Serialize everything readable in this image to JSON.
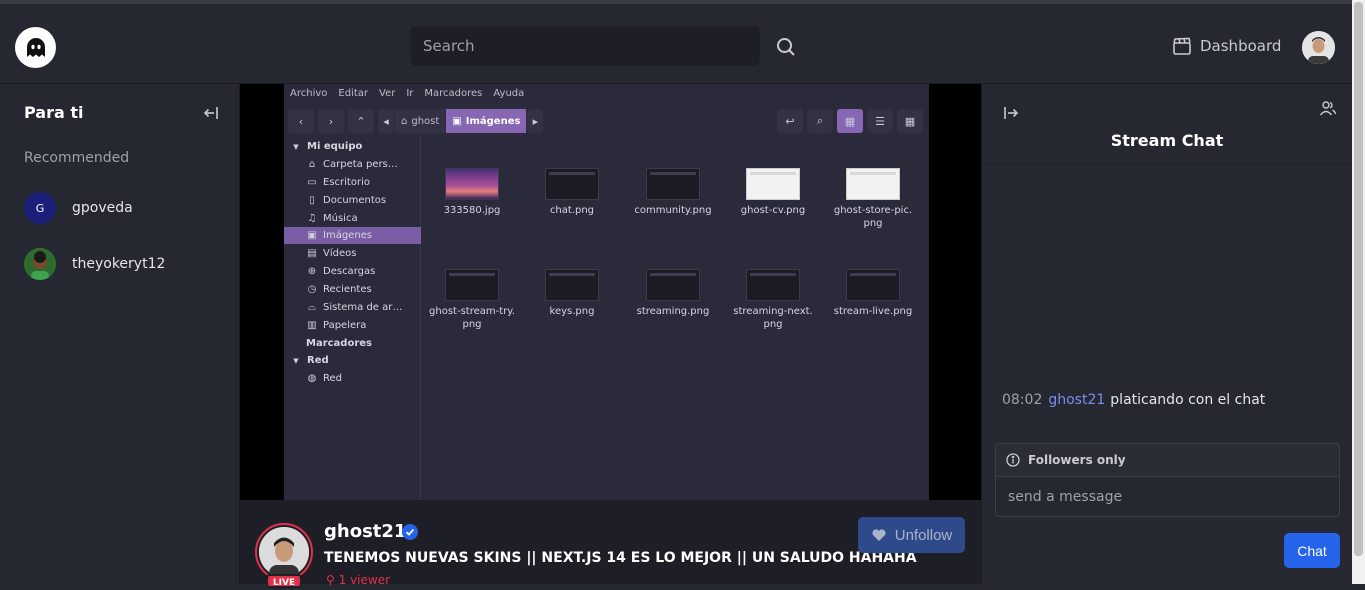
{
  "header": {
    "search_placeholder": "Search",
    "dashboard_label": "Dashboard"
  },
  "sidebar": {
    "title": "Para ti",
    "recommended_label": "Recommended",
    "channels": [
      {
        "name": "gpoveda",
        "initial": "G"
      },
      {
        "name": "theyokeryt12"
      }
    ]
  },
  "file_manager": {
    "menu": [
      "Archivo",
      "Editar",
      "Ver",
      "Ir",
      "Marcadores",
      "Ayuda"
    ],
    "breadcrumb": [
      "ghost",
      "Imágenes"
    ],
    "sidebar": {
      "section_equipo": "Mi equipo",
      "items": [
        "Carpeta pers…",
        "Escritorio",
        "Documentos",
        "Música",
        "Imágenes",
        "Vídeos",
        "Descargas",
        "Recientes",
        "Sistema de ar…",
        "Papelera"
      ],
      "section_marcadores": "Marcadores",
      "section_red": "Red",
      "red_item": "Red"
    },
    "files": [
      "333580.jpg",
      "chat.png",
      "community.png",
      "ghost-cv.png",
      "ghost-store-pic.\npng",
      "ghost-stream-try.\npng",
      "keys.png",
      "streaming.png",
      "streaming-next.\npng",
      "stream-live.png"
    ]
  },
  "stream": {
    "streamer_name": "ghost21",
    "live_badge": "LIVE",
    "title": "TENEMOS NUEVAS SKINS || NEXT.JS 14 ES LO MEJOR || UN SALUDO HAHAHA",
    "viewers": "1 viewer",
    "unfollow_label": "Unfollow"
  },
  "chat": {
    "title": "Stream Chat",
    "messages": [
      {
        "time": "08:02",
        "user": "ghost21",
        "text": "platicando con el chat"
      }
    ],
    "followers_only": "Followers only",
    "input_placeholder": "send a message",
    "send_label": "Chat"
  },
  "colors": {
    "accent": "#2563eb",
    "live": "#e0314b",
    "username": "#7a8cf0"
  }
}
